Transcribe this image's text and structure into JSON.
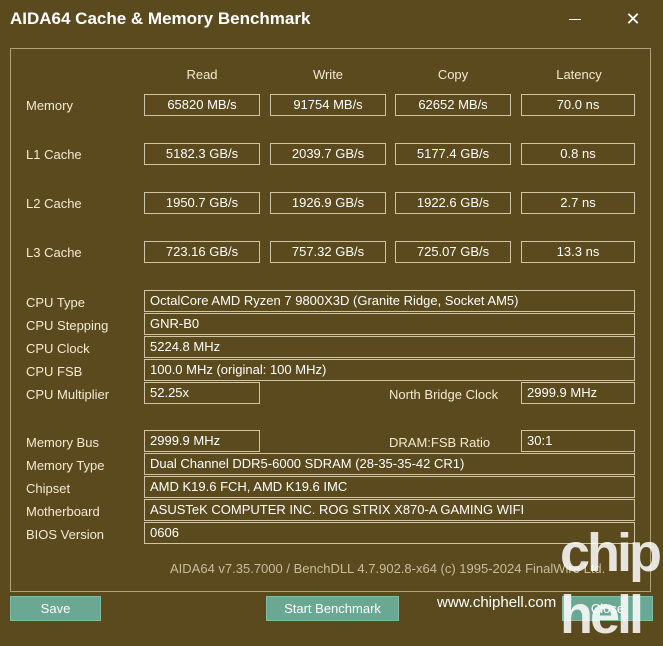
{
  "window": {
    "title": "AIDA64 Cache & Memory Benchmark",
    "close_glyph": "✕"
  },
  "columns": [
    "Read",
    "Write",
    "Copy",
    "Latency"
  ],
  "bench_rows": [
    {
      "label": "Memory",
      "values": [
        "65820 MB/s",
        "91754 MB/s",
        "62652 MB/s",
        "70.0 ns"
      ]
    },
    {
      "label": "L1 Cache",
      "values": [
        "5182.3 GB/s",
        "2039.7 GB/s",
        "5177.4 GB/s",
        "0.8 ns"
      ]
    },
    {
      "label": "L2 Cache",
      "values": [
        "1950.7 GB/s",
        "1926.9 GB/s",
        "1922.6 GB/s",
        "2.7 ns"
      ]
    },
    {
      "label": "L3 Cache",
      "values": [
        "723.16 GB/s",
        "757.32 GB/s",
        "725.07 GB/s",
        "13.3 ns"
      ]
    }
  ],
  "cpu": {
    "type_label": "CPU Type",
    "type_value": "OctalCore AMD Ryzen 7 9800X3D  (Granite Ridge, Socket AM5)",
    "stepping_label": "CPU Stepping",
    "stepping_value": "GNR-B0",
    "clock_label": "CPU Clock",
    "clock_value": "5224.8 MHz",
    "fsb_label": "CPU FSB",
    "fsb_value": "100.0 MHz  (original: 100 MHz)",
    "multiplier_label": "CPU Multiplier",
    "multiplier_value": "52.25x",
    "nb_clock_label": "North Bridge Clock",
    "nb_clock_value": "2999.9 MHz"
  },
  "system": {
    "membus_label": "Memory Bus",
    "membus_value": "2999.9 MHz",
    "dram_ratio_label": "DRAM:FSB Ratio",
    "dram_ratio_value": "30:1",
    "memtype_label": "Memory Type",
    "memtype_value": "Dual Channel DDR5-6000 SDRAM  (28-35-35-42 CR1)",
    "chipset_label": "Chipset",
    "chipset_value": "AMD K19.6 FCH, AMD K19.6 IMC",
    "motherboard_label": "Motherboard",
    "motherboard_value": "ASUSTeK COMPUTER INC. ROG STRIX X870-A GAMING WIFI",
    "bios_label": "BIOS Version",
    "bios_value": "0606"
  },
  "footer": "AIDA64 v7.35.7000 / BenchDLL 4.7.902.8-x64  (c) 1995-2024 FinalWire Ltd.",
  "buttons": {
    "save": "Save",
    "start": "Start Benchmark",
    "close": "Close"
  },
  "watermark": {
    "logo_text": "chip hell",
    "url": "www.chiphell.com"
  }
}
